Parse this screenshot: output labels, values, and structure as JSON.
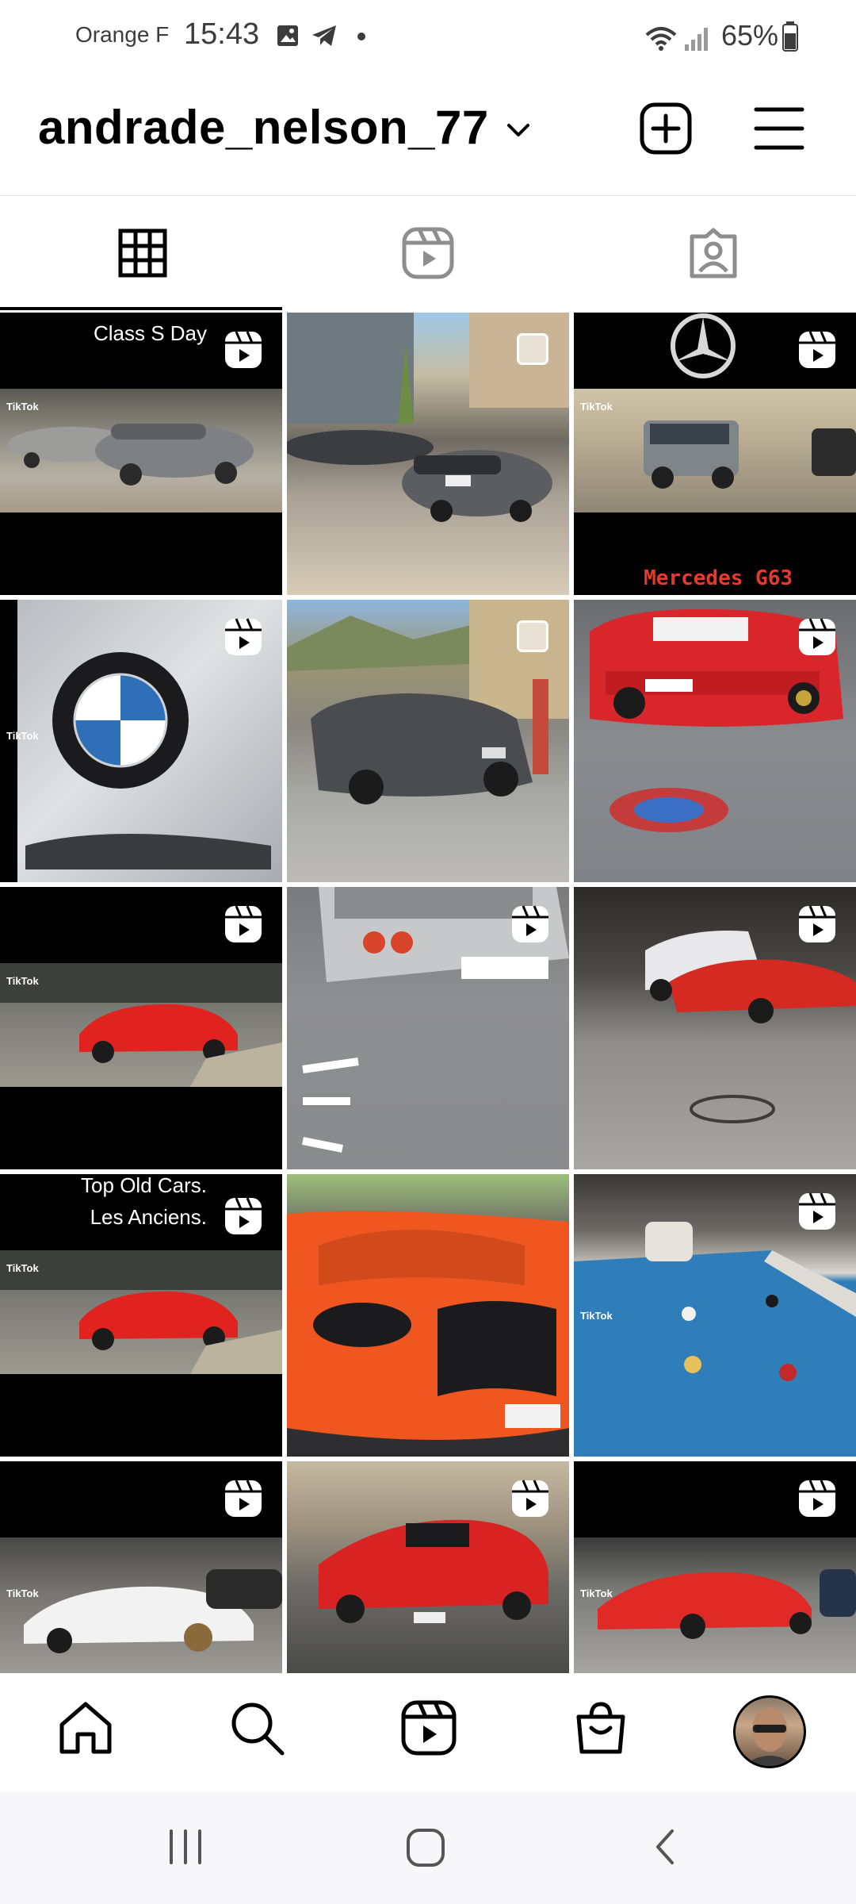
{
  "status_bar": {
    "carrier": "Orange F",
    "time": "15:43",
    "battery": "65%",
    "icons": [
      "gallery-icon",
      "telegram-icon",
      "dot-icon",
      "wifi-icon",
      "signal-icon",
      "battery-icon"
    ]
  },
  "header": {
    "username": "andrade_nelson_77",
    "icons": [
      "chevron-down-icon",
      "new-post-icon",
      "menu-icon"
    ]
  },
  "tabs": [
    {
      "name": "grid",
      "icon": "grid-icon",
      "selected": true
    },
    {
      "name": "reels",
      "icon": "reels-icon",
      "selected": false
    },
    {
      "name": "tagged",
      "icon": "tagged-icon",
      "selected": false
    }
  ],
  "grid": {
    "tiles": [
      {
        "caption": "Class S Day",
        "type": "reel",
        "watermark": "TikTok"
      },
      {
        "caption": "",
        "type": "multi"
      },
      {
        "caption": "Mercedes G63",
        "type": "reel",
        "watermark": "TikTok"
      },
      {
        "caption": "",
        "type": "reel",
        "watermark": "TikTok"
      },
      {
        "caption": "",
        "type": "multi"
      },
      {
        "caption": "",
        "type": "reel"
      },
      {
        "caption": "",
        "type": "reel",
        "watermark": "TikTok"
      },
      {
        "caption": "",
        "type": "reel"
      },
      {
        "caption": "",
        "type": "reel"
      },
      {
        "caption_lines": [
          "Top Old Cars.",
          "Les Anciens."
        ],
        "type": "reel",
        "watermark": "TikTok"
      },
      {
        "caption": "",
        "type": "none"
      },
      {
        "caption": "",
        "type": "reel",
        "watermark": "TikTok"
      },
      {
        "caption": "",
        "type": "reel",
        "watermark": "TikTok"
      },
      {
        "caption": "",
        "type": "reel"
      },
      {
        "caption": "",
        "type": "reel",
        "watermark": "TikTok"
      }
    ]
  },
  "bottom_nav": {
    "items": [
      "home-icon",
      "search-icon",
      "reels-icon",
      "shop-icon",
      "profile-avatar"
    ]
  },
  "system_nav": {
    "items": [
      "recents-icon",
      "home-button-icon",
      "back-icon"
    ]
  },
  "colors": {
    "accent": "#000000",
    "background": "#ffffff",
    "caption_red": "#e53a2c"
  }
}
